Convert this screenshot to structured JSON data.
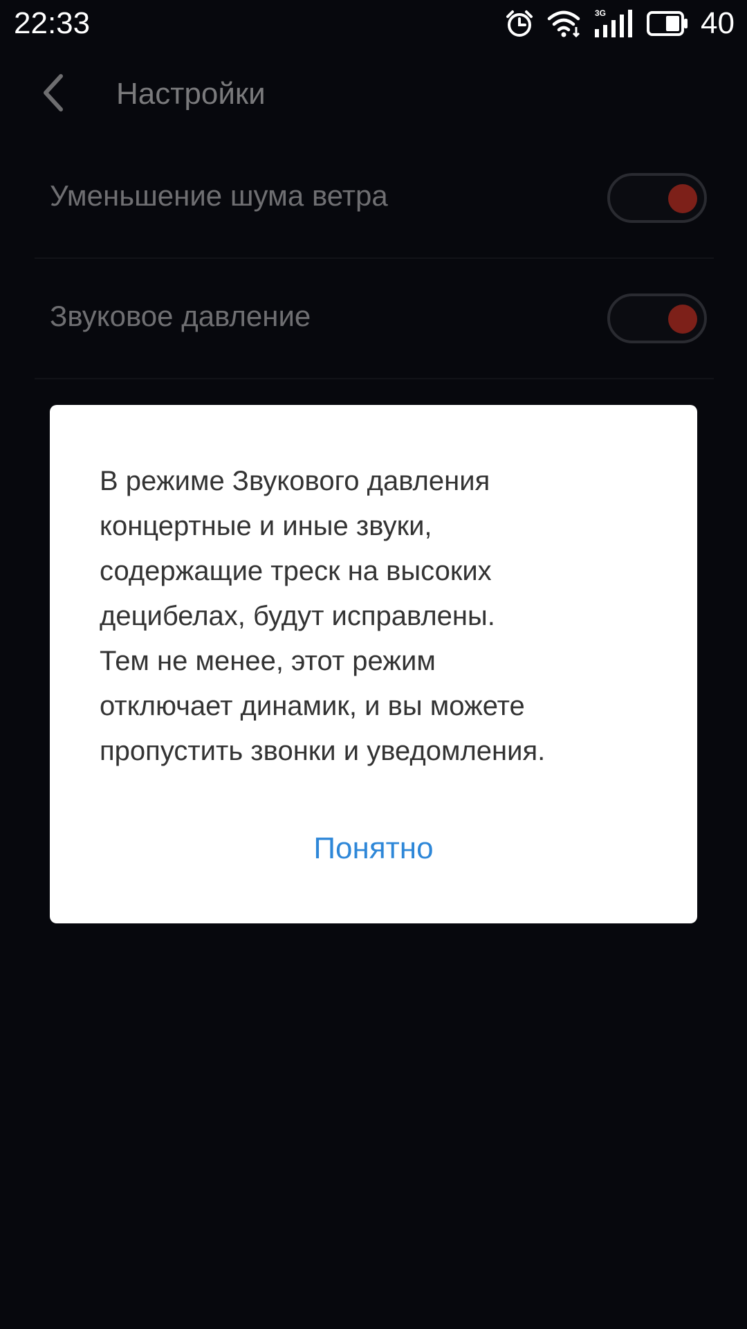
{
  "status_bar": {
    "time": "22:33",
    "icons": [
      "alarm-icon",
      "wifi-icon",
      "3g-signal-icon",
      "battery-icon"
    ],
    "network_label": "3G",
    "battery_level": "40"
  },
  "header": {
    "back_icon": "chevron-left-icon",
    "title": "Настройки"
  },
  "settings": {
    "items": [
      {
        "label": "Уменьшение шума ветра",
        "toggle_on": true
      },
      {
        "label": "Звуковое давление",
        "toggle_on": true
      }
    ]
  },
  "dialog": {
    "message": "В режиме Звукового давления\nконцертные и иные звуки,\nсодержащие треск на высоких\nдецибелах, будут исправлены.\n Тем не менее, этот режим\nотключает динамик, и вы можете\nпропустить звонки и уведомления.",
    "button_label": "Понятно"
  },
  "colors": {
    "background": "#07080d",
    "dialog_background": "#ffffff",
    "accent": "#2e87d8",
    "toggle_knob": "#7d2019"
  }
}
